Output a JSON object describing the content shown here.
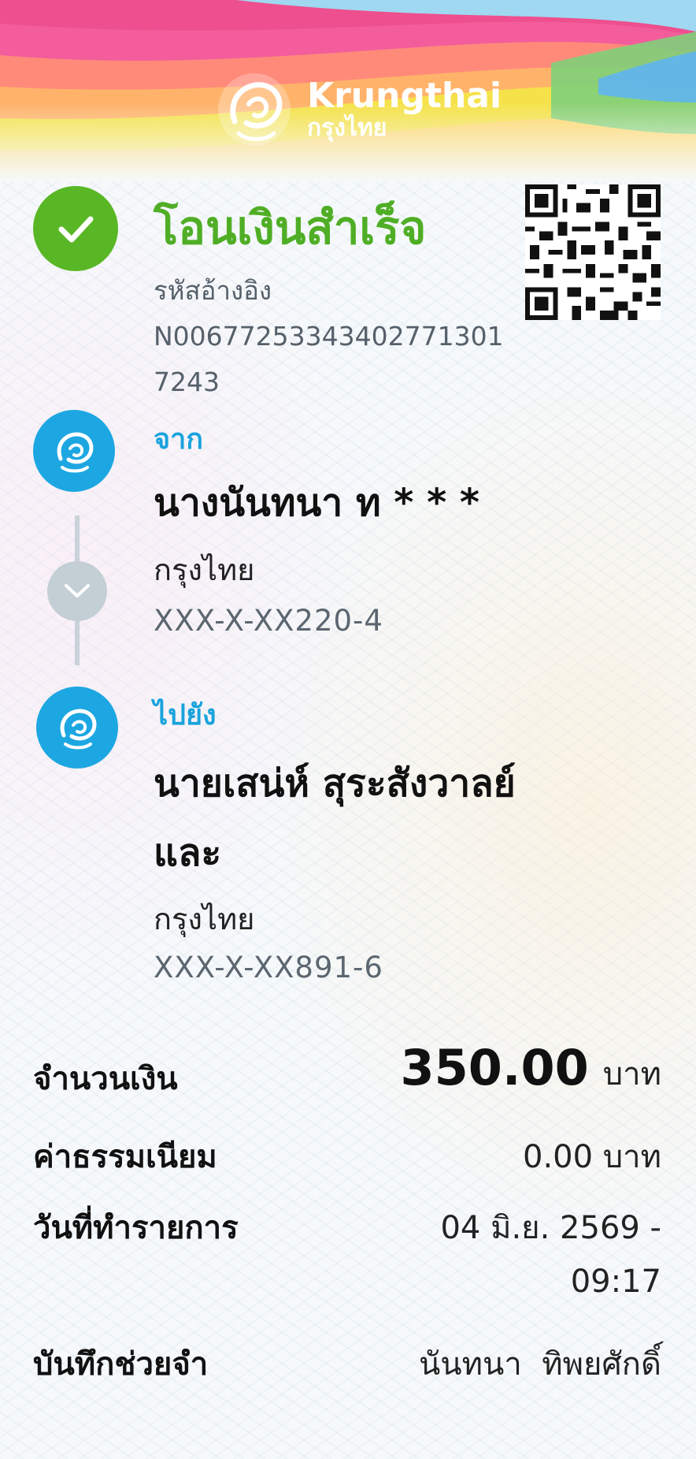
{
  "header": {
    "brand_en": "Krungthai",
    "brand_th": "กรุงไทย"
  },
  "status": {
    "title": "โอนเงินสำเร็จ",
    "ref_label": "รหัสอ้างอิง",
    "ref_value": "N006772533434027713017243",
    "icon": "check-icon",
    "color": "#59b726"
  },
  "from": {
    "label": "จาก",
    "name": "นางนันทนา ท * * *",
    "bank": "กรุงไทย",
    "account": "XXX-X-XX220-4"
  },
  "to": {
    "label": "ไปยัง",
    "name_line1": "นายเสน่ห์ สุระสังวาลย์",
    "name_line2": "และ",
    "bank": "กรุงไทย",
    "account": "XXX-X-XX891-6"
  },
  "details": {
    "amount_label": "จำนวนเงิน",
    "amount_value": "350.00",
    "amount_unit": "บาท",
    "fee_label": "ค่าธรรมเนียม",
    "fee_value": "0.00 บาท",
    "date_label": "วันที่ทำรายการ",
    "date_value_line1": "04 มิ.ย. 2569 -",
    "date_value_line2": "09:17",
    "memo_label": "บันทึกช่วยจำ",
    "memo_value": "นันทนา  ทิพยศักดิ์"
  },
  "colors": {
    "success": "#4fae25",
    "accent": "#1aa3dc"
  }
}
